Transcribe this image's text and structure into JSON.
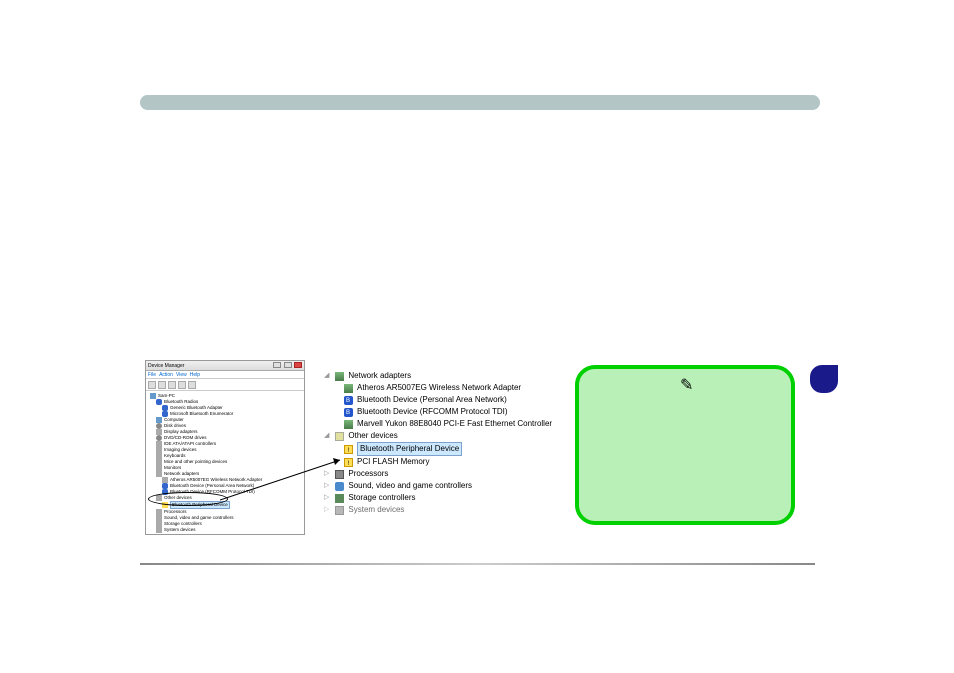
{
  "header": {
    "title": ""
  },
  "dm": {
    "title": "Device Manager",
    "menus": [
      "File",
      "Action",
      "View",
      "Help"
    ],
    "root": "Sam-PC",
    "cats": {
      "bluetooth_radios": "Bluetooth Radios",
      "generic_bt": "Generic Bluetooth Adapter",
      "ms_bt": "Microsoft Bluetooth Enumerator",
      "computer": "Computer",
      "disk_drives": "Disk drives",
      "display": "Display adapters",
      "dvd": "DVD/CD-ROM drives",
      "ide": "IDE ATA/ATAPI controllers",
      "imaging": "Imaging devices",
      "keyboards": "Keyboards",
      "mice": "Mice and other pointing devices",
      "monitors": "Monitors",
      "network_adapters": "Network adapters",
      "atheros_sm": "Atheros AR5007EG Wireless Network Adapter",
      "bt_pan_sm": "Bluetooth Device (Personal Area Network)",
      "bt_rfcomm_sm": "Bluetooth Device (RFCOMM Protocol TDI)",
      "other_devices": "Other devices",
      "bt_periph": "Bluetooth Peripheral Device",
      "processors": "Processors",
      "sound": "Sound, video and game controllers",
      "storage": "Storage controllers",
      "system": "System devices"
    }
  },
  "zoom": {
    "network_adapters": "Network adapters",
    "atheros": "Atheros AR5007EG Wireless Network Adapter",
    "bt_pan": "Bluetooth Device (Personal Area Network)",
    "bt_rfcomm": "Bluetooth Device (RFCOMM Protocol TDI)",
    "marvell": "Marvell Yukon 88E8040 PCI-E Fast Ethernet Controller",
    "other_devices": "Other devices",
    "bt_periph": "Bluetooth Peripheral Device",
    "pci_flash": "PCI FLASH Memory",
    "processors": "Processors",
    "sound": "Sound, video and game controllers",
    "storage": "Storage controllers",
    "system": "System devices"
  },
  "callout": {
    "text": ""
  }
}
